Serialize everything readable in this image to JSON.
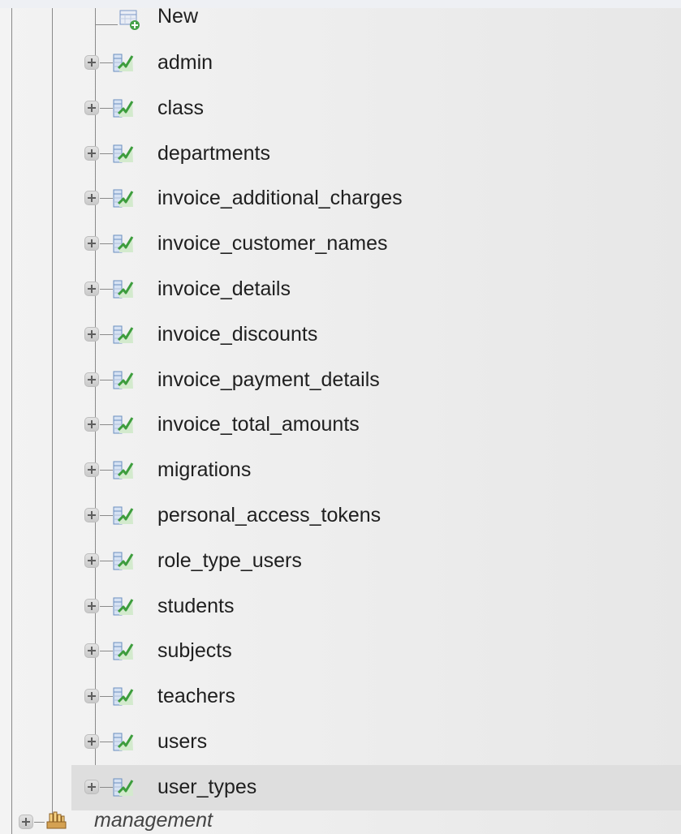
{
  "tree": {
    "new_item": {
      "label": "New",
      "icon": "new-table-icon"
    },
    "tables": [
      {
        "label": "admin",
        "icon": "table-icon",
        "expander": "plus-icon"
      },
      {
        "label": "class",
        "icon": "table-icon",
        "expander": "plus-icon"
      },
      {
        "label": "departments",
        "icon": "table-icon",
        "expander": "plus-icon"
      },
      {
        "label": "invoice_additional_charges",
        "icon": "table-icon",
        "expander": "plus-icon"
      },
      {
        "label": "invoice_customer_names",
        "icon": "table-icon",
        "expander": "plus-icon"
      },
      {
        "label": "invoice_details",
        "icon": "table-icon",
        "expander": "plus-icon"
      },
      {
        "label": "invoice_discounts",
        "icon": "table-icon",
        "expander": "plus-icon"
      },
      {
        "label": "invoice_payment_details",
        "icon": "table-icon",
        "expander": "plus-icon"
      },
      {
        "label": "invoice_total_amounts",
        "icon": "table-icon",
        "expander": "plus-icon"
      },
      {
        "label": "migrations",
        "icon": "table-icon",
        "expander": "plus-icon"
      },
      {
        "label": "personal_access_tokens",
        "icon": "table-icon",
        "expander": "plus-icon"
      },
      {
        "label": "role_type_users",
        "icon": "table-icon",
        "expander": "plus-icon"
      },
      {
        "label": "students",
        "icon": "table-icon",
        "expander": "plus-icon"
      },
      {
        "label": "subjects",
        "icon": "table-icon",
        "expander": "plus-icon"
      },
      {
        "label": "teachers",
        "icon": "table-icon",
        "expander": "plus-icon"
      },
      {
        "label": "users",
        "icon": "table-icon",
        "expander": "plus-icon"
      },
      {
        "label": "user_types",
        "icon": "table-icon",
        "expander": "plus-icon",
        "highlighted": true
      }
    ],
    "next_database": {
      "label": "management",
      "icon": "database-icon",
      "expander": "plus-icon"
    }
  },
  "colors": {
    "highlight": "#dedede",
    "text": "#1f1f1f",
    "tree_line": "#8a8a8a",
    "icon_green": "#3d9d3d",
    "icon_blue": "#6a8fbf"
  }
}
